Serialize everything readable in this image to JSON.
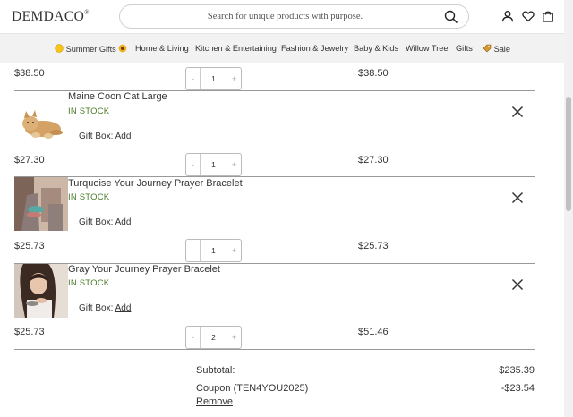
{
  "header": {
    "logo": "DEMDACO",
    "search_placeholder": "Search for unique products with purpose."
  },
  "nav": {
    "items": [
      {
        "label": "Summer Gifts",
        "icon": "sun-emoji-icon",
        "trailing_icon": "sunflower-emoji-icon"
      },
      {
        "label": "Home & Living"
      },
      {
        "label": "Kitchen & Entertaining"
      },
      {
        "label": "Fashion & Jewelry"
      },
      {
        "label": "Baby & Kids"
      },
      {
        "label": "Willow Tree"
      },
      {
        "label": "Gifts"
      },
      {
        "label": "Sale",
        "icon": "tag-emoji-icon"
      }
    ]
  },
  "cart": {
    "top_item": {
      "unit_price": "$38.50",
      "quantity": "1",
      "total": "$38.50"
    },
    "items": [
      {
        "name": "Maine Coon Cat Large",
        "stock": "IN STOCK",
        "gift_label": "Gift Box:",
        "gift_link": "Add",
        "unit_price": "$27.30",
        "quantity": "1",
        "total": "$27.30",
        "thumb": "cat-plush"
      },
      {
        "name": "Turquoise Your Journey Prayer Bracelet",
        "stock": "IN STOCK",
        "gift_label": "Gift Box:",
        "gift_link": "Add",
        "unit_price": "$25.73",
        "quantity": "1",
        "total": "$25.73",
        "thumb": "bracelet-lifestyle"
      },
      {
        "name": "Gray Your Journey Prayer Bracelet",
        "stock": "IN STOCK",
        "gift_label": "Gift Box:",
        "gift_link": "Add",
        "unit_price": "$25.73",
        "quantity": "2",
        "total": "$51.46",
        "thumb": "woman-portrait"
      }
    ],
    "qty_minus": "-",
    "qty_plus": "+"
  },
  "summary": {
    "subtotal_label": "Subtotal:",
    "subtotal_value": "$235.39",
    "coupon_label": "Coupon (TEN4YOU2025)",
    "coupon_value": "-$23.54",
    "remove_label": "Remove"
  },
  "colors": {
    "stock_green": "#4a7a28",
    "nav_bg": "#f2f2f2"
  }
}
